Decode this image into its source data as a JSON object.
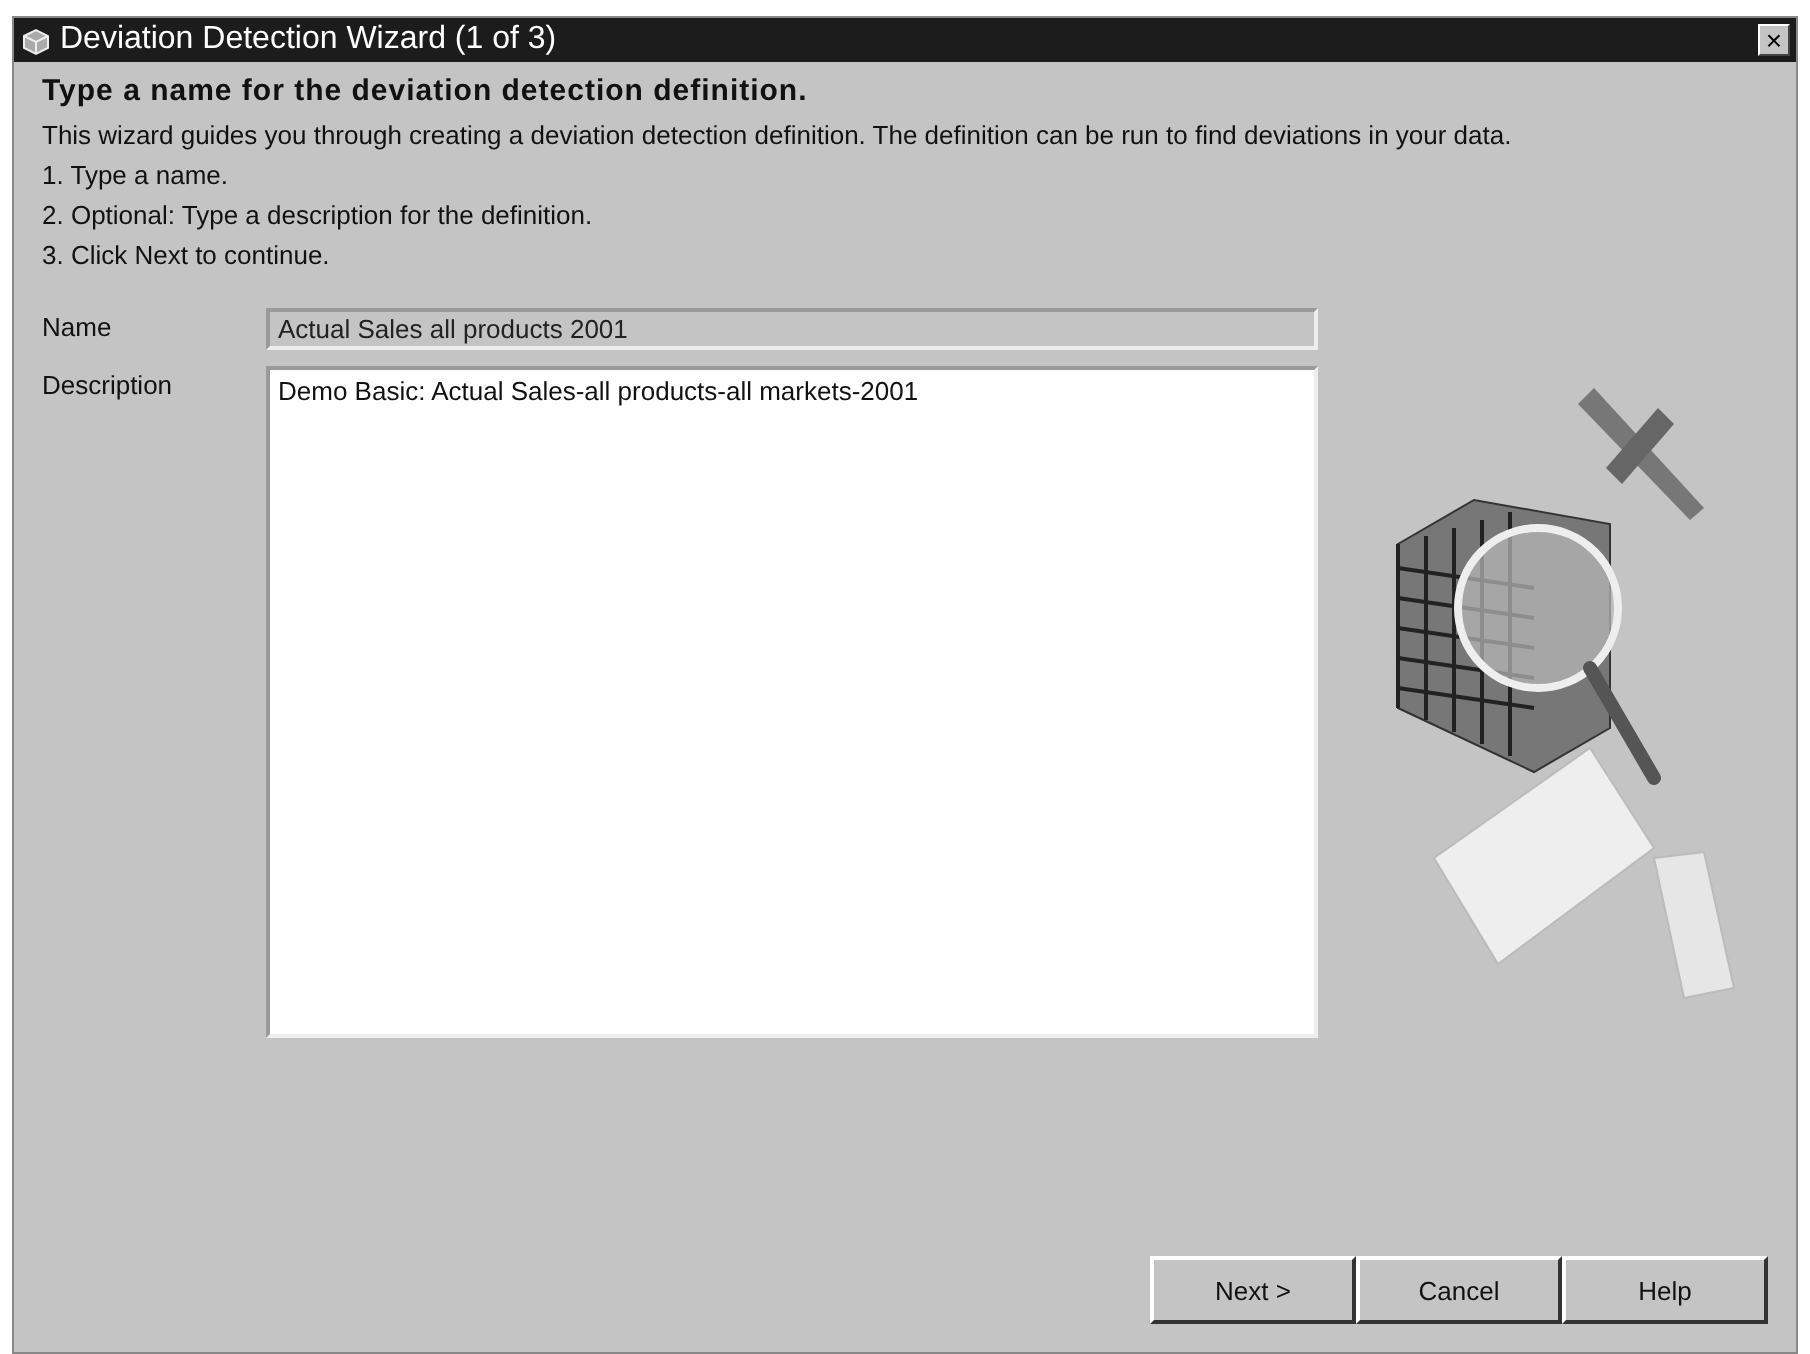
{
  "window": {
    "title": "Deviation Detection Wizard (1 of 3)",
    "close": "×"
  },
  "heading": "Type a name for the deviation detection definition.",
  "intro": "This wizard guides you through creating a deviation detection definition. The definition can be run to find deviations in your data.",
  "steps": [
    "1. Type a name.",
    "2. Optional: Type a description for the definition.",
    "3. Click Next to continue."
  ],
  "fields": [
    {
      "kind": "line",
      "label": "Name",
      "value": "Actual Sales all products 2001",
      "disabled": true
    },
    {
      "kind": "area",
      "label": "Description",
      "value": "Demo Basic: Actual Sales-all products-all markets-2001",
      "disabled": false
    }
  ],
  "buttons": [
    "Next >",
    "Cancel",
    "Help"
  ]
}
